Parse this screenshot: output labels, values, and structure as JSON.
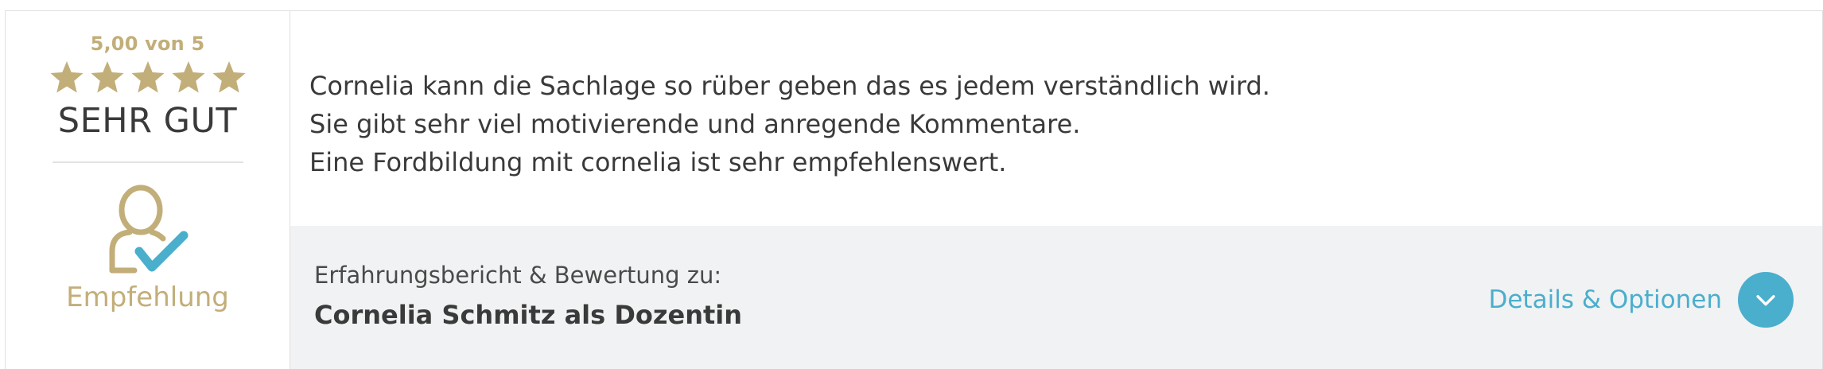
{
  "rating": {
    "score_text": "5,00 von 5",
    "value": 5,
    "max": 5,
    "verdict": "SEHR GUT",
    "recommendation_label": "Empfehlung",
    "star_color": "#c2ae79"
  },
  "review": {
    "lines": [
      "Cornelia kann die Sachlage so rüber geben das es jedem verständlich wird.",
      "Sie gibt sehr viel motivierende und anregende Kommentare.",
      "Eine Fordbildung mit cornelia ist sehr empfehlenswert."
    ]
  },
  "footer": {
    "label": "Erfahrungsbericht & Bewertung zu:",
    "subject": "Cornelia Schmitz als Dozentin",
    "details_label": "Details & Optionen",
    "details_icon": "chevron-down-icon"
  },
  "colors": {
    "gold": "#c2ae79",
    "accent": "#4aaecd",
    "footer_bg": "#f1f2f3"
  }
}
